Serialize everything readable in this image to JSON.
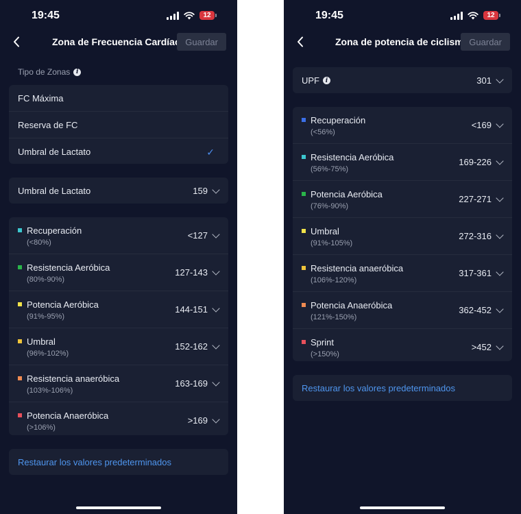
{
  "status": {
    "time": "19:45",
    "battery": "12"
  },
  "hr": {
    "title": "Zona de Frecuencia Cardíaca",
    "save": "Guardar",
    "section_label": "Tipo de Zonas",
    "types": [
      {
        "label": "FC Máxima",
        "selected": false
      },
      {
        "label": "Reserva de FC",
        "selected": false
      },
      {
        "label": "Umbral de Lactato",
        "selected": true
      }
    ],
    "check": "✓",
    "threshold": {
      "label": "Umbral de Lactato",
      "value": "159"
    },
    "zones": [
      {
        "name": "Recuperación",
        "range": "(<80%)",
        "value": "<127",
        "color": "#3cc7cf"
      },
      {
        "name": "Resistencia Aeróbica",
        "range": "(80%-90%)",
        "value": "127-143",
        "color": "#2ab54a"
      },
      {
        "name": "Potencia Aeróbica",
        "range": "(91%-95%)",
        "value": "144-151",
        "color": "#f1e34a"
      },
      {
        "name": "Umbral",
        "range": "(96%-102%)",
        "value": "152-162",
        "color": "#f0c43a"
      },
      {
        "name": "Resistencia anaeróbica",
        "range": "(103%-106%)",
        "value": "163-169",
        "color": "#f08b52"
      },
      {
        "name": "Potencia Anaeróbica",
        "range": "(>106%)",
        "value": ">169",
        "color": "#e8505b"
      }
    ],
    "restore": "Restaurar los valores predeterminados"
  },
  "power": {
    "title": "Zona de potencia de ciclismo",
    "save": "Guardar",
    "upf": {
      "label": "UPF",
      "value": "301"
    },
    "zones": [
      {
        "name": "Recuperación",
        "range": "(<56%)",
        "value": "<169",
        "color": "#3b6fe8"
      },
      {
        "name": "Resistencia Aeróbica",
        "range": "(56%-75%)",
        "value": "169-226",
        "color": "#3cc7cf"
      },
      {
        "name": "Potencia Aeróbica",
        "range": "(76%-90%)",
        "value": "227-271",
        "color": "#2ab54a"
      },
      {
        "name": "Umbral",
        "range": "(91%-105%)",
        "value": "272-316",
        "color": "#f1e34a"
      },
      {
        "name": "Resistencia anaeróbica",
        "range": "(106%-120%)",
        "value": "317-361",
        "color": "#f0c43a"
      },
      {
        "name": "Potencia Anaeróbica",
        "range": "(121%-150%)",
        "value": "362-452",
        "color": "#f08b52"
      },
      {
        "name": "Sprint",
        "range": "(>150%)",
        "value": ">452",
        "color": "#e8505b"
      }
    ],
    "restore": "Restaurar los valores predeterminados"
  }
}
